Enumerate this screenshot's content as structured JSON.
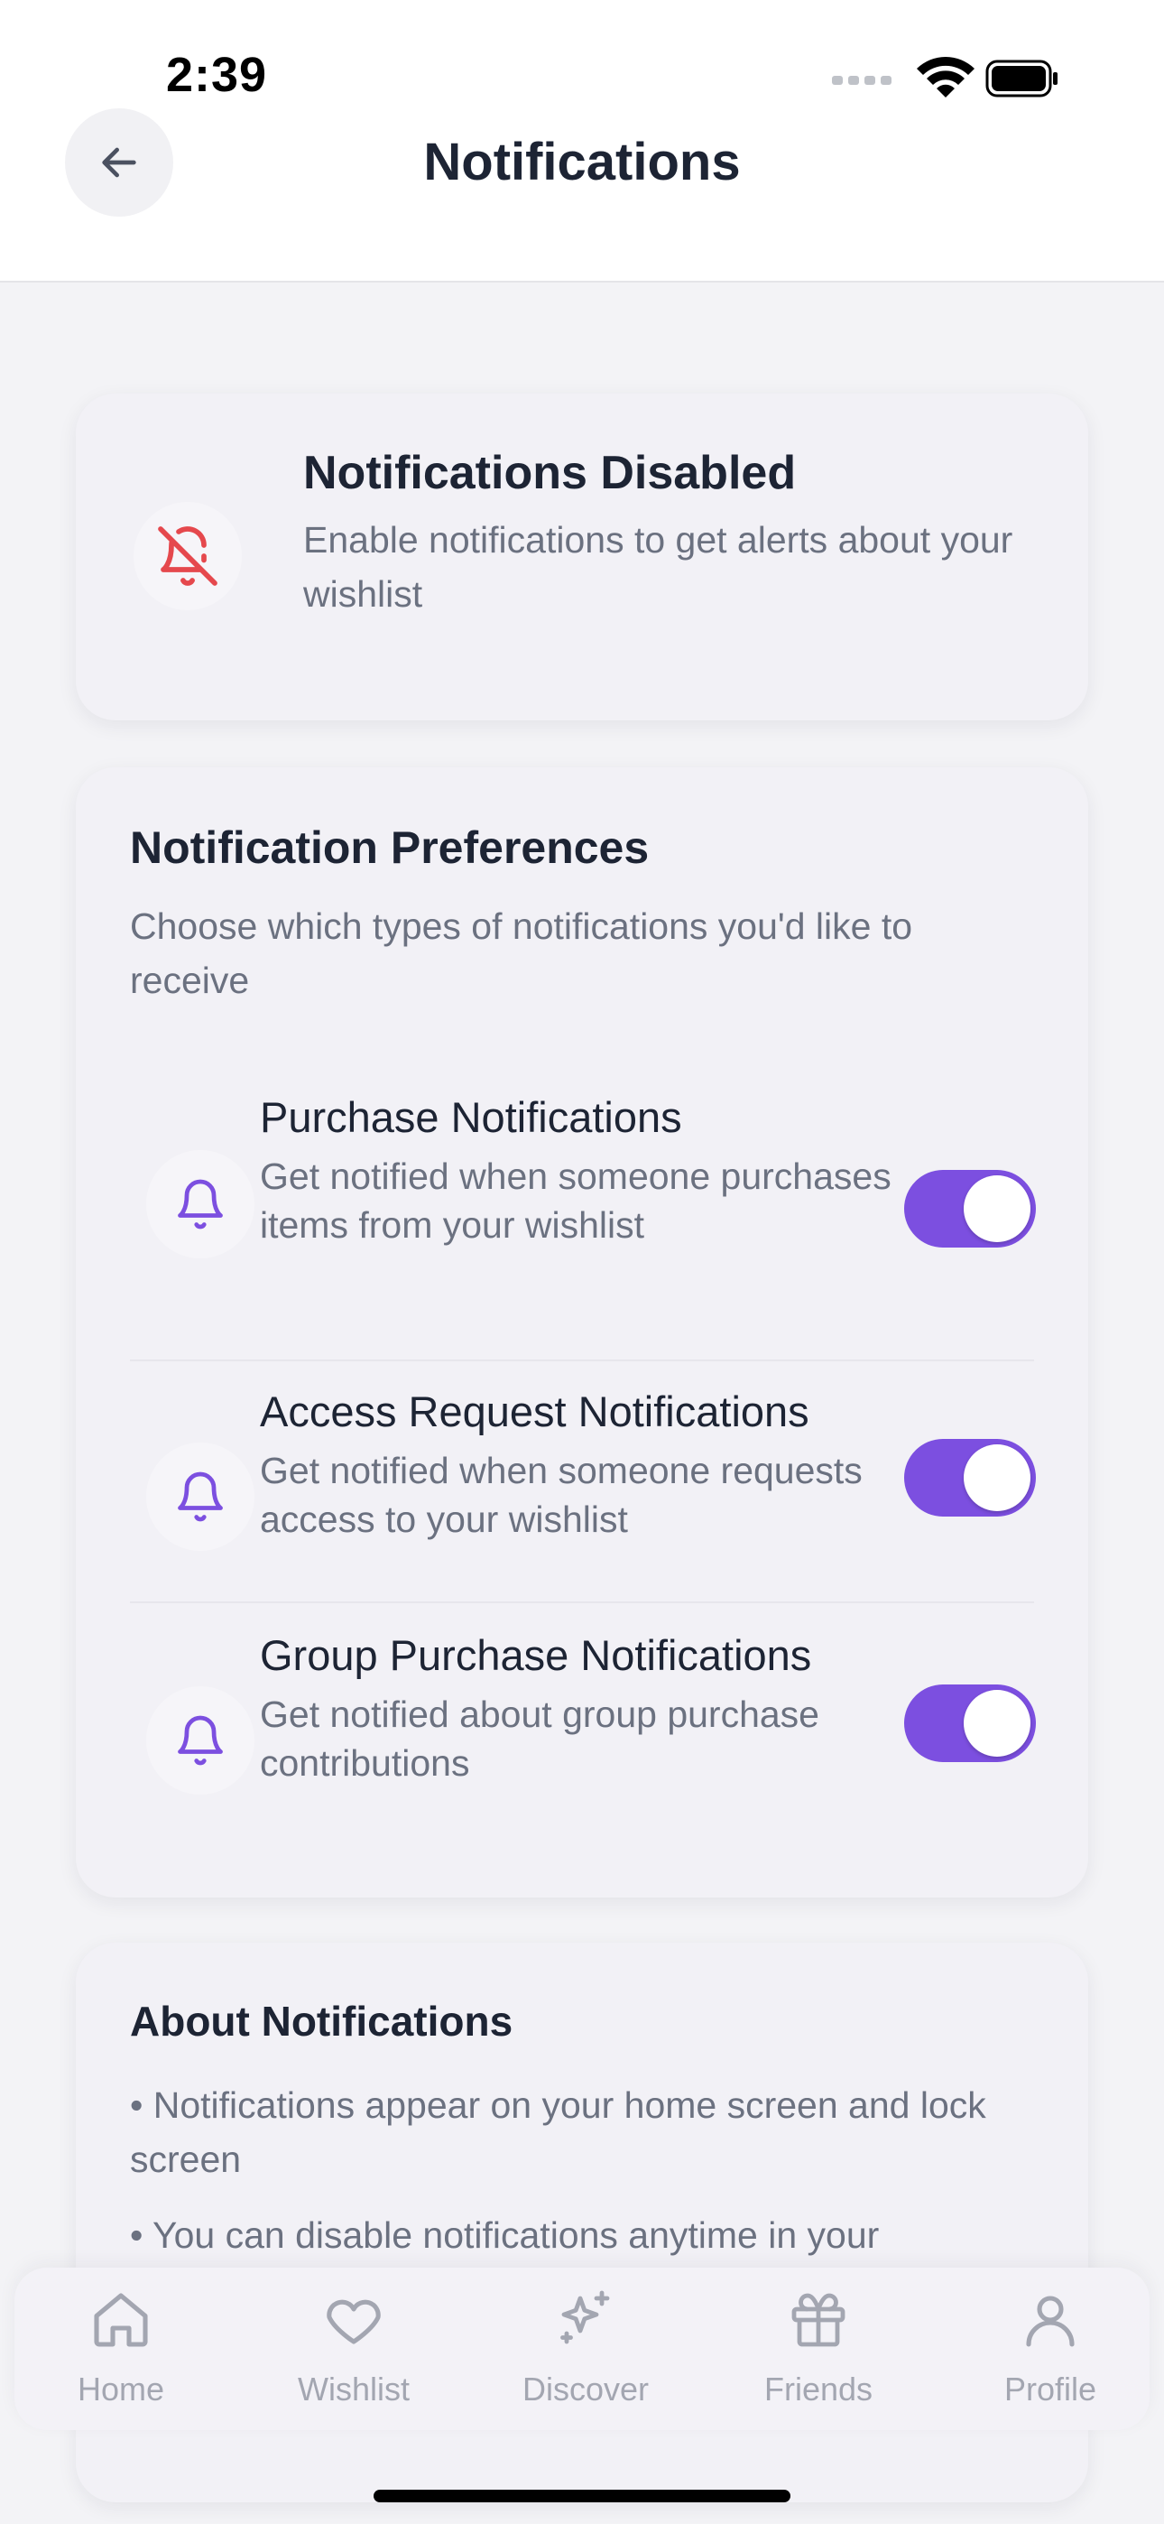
{
  "status_bar": {
    "time": "2:39"
  },
  "header": {
    "title": "Notifications"
  },
  "disabled_card": {
    "title": "Notifications Disabled",
    "description": "Enable notifications to get alerts about your wishlist"
  },
  "preferences": {
    "title": "Notification Preferences",
    "description": "Choose which types of notifications you'd like to receive",
    "items": [
      {
        "title": "Purchase Notifications",
        "description": "Get notified when someone purchases items from your wishlist",
        "enabled": true
      },
      {
        "title": "Access Request Notifications",
        "description": "Get notified when someone requests access to your wishlist",
        "enabled": true
      },
      {
        "title": "Group Purchase Notifications",
        "description": "Get notified about group purchase contributions",
        "enabled": true
      }
    ]
  },
  "about": {
    "title": "About Notifications",
    "items": [
      "• Notifications appear on your home screen and lock screen",
      "• You can disable notifications anytime in your"
    ]
  },
  "tab_bar": {
    "tabs": [
      {
        "label": "Home",
        "icon": "home-icon"
      },
      {
        "label": "Wishlist",
        "icon": "heart-icon"
      },
      {
        "label": "Discover",
        "icon": "sparkles-icon"
      },
      {
        "label": "Friends",
        "icon": "gift-icon"
      },
      {
        "label": "Profile",
        "icon": "user-icon"
      }
    ]
  },
  "colors": {
    "accent": "#7c4fe0",
    "alert": "#e5484d",
    "muted_text": "#6b7180",
    "tab_inactive": "#a3a6b1"
  }
}
